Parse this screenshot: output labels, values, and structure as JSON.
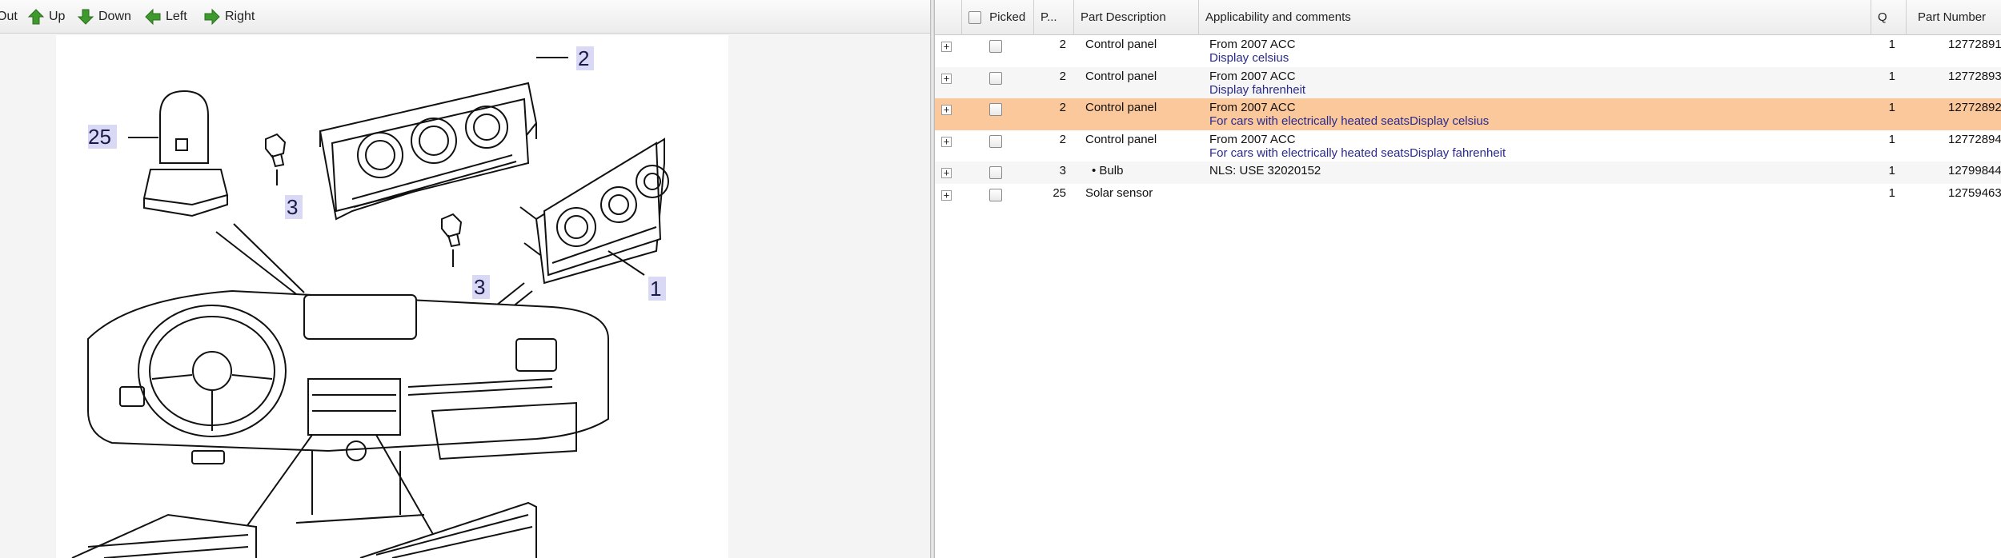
{
  "toolbar": {
    "buttons": [
      {
        "label": "Out",
        "icon": "zoom-out-icon"
      },
      {
        "label": "Up",
        "icon": "arrow-up-icon"
      },
      {
        "label": "Down",
        "icon": "arrow-down-icon"
      },
      {
        "label": "Left",
        "icon": "arrow-left-icon"
      },
      {
        "label": "Right",
        "icon": "arrow-right-icon"
      }
    ],
    "icon_color": "#3f9a2e"
  },
  "diagram": {
    "callouts": [
      "2",
      "25",
      "3",
      "3",
      "1"
    ]
  },
  "grid": {
    "columns": [
      "Picked",
      "P...",
      "Part Description",
      "Applicability and comments",
      "Q",
      "Part Number"
    ],
    "selected_row_color": "#fbc89c",
    "rows": [
      {
        "pos": "2",
        "description": "Control panel",
        "comment_line1": "From 2007 ACC",
        "comment_line2": "Display celsius",
        "qty": "1",
        "part_number": "12772891"
      },
      {
        "pos": "2",
        "description": "Control panel",
        "comment_line1": "From 2007 ACC",
        "comment_line2": "Display fahrenheit",
        "qty": "1",
        "part_number": "12772893"
      },
      {
        "pos": "2",
        "description": "Control panel",
        "comment_line1": "From 2007 ACC",
        "comment_line2": "For cars with electrically heated seatsDisplay celsius",
        "qty": "1",
        "part_number": "12772892"
      },
      {
        "pos": "2",
        "description": "Control panel",
        "comment_line1": "From 2007 ACC",
        "comment_line2": "For cars with electrically heated seatsDisplay fahrenheit",
        "qty": "1",
        "part_number": "12772894"
      },
      {
        "pos": "3",
        "description": "• Bulb",
        "comment_line1": "NLS: USE 32020152",
        "comment_line2": "",
        "qty": "1",
        "part_number": "12799844"
      },
      {
        "pos": "25",
        "description": "Solar sensor",
        "comment_line1": "",
        "comment_line2": "",
        "qty": "1",
        "part_number": "12759463"
      }
    ]
  }
}
